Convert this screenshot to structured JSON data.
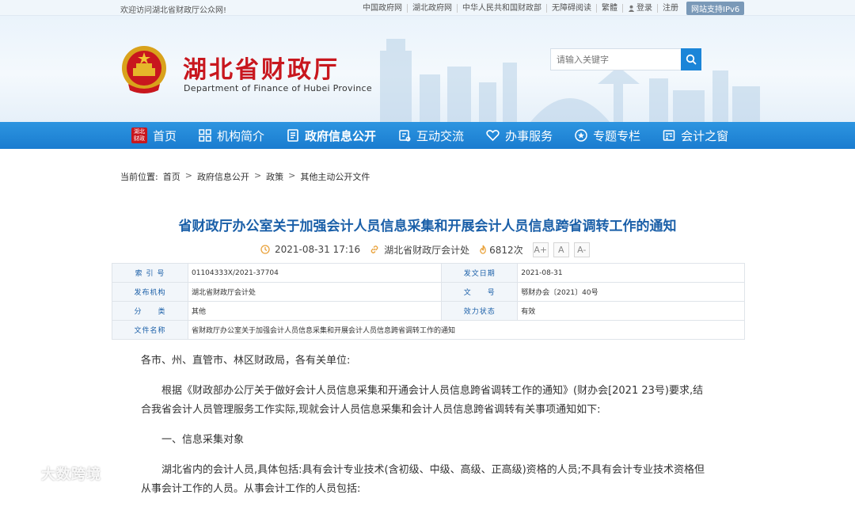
{
  "topbar": {
    "welcome": "欢迎访问湖北省财政厅公众网!",
    "links": [
      "中国政府网",
      "湖北政府网",
      "中华人民共和国财政部",
      "无障碍阅读",
      "繁體",
      "登录",
      "注册"
    ],
    "ipv6": "网站支持IPv6"
  },
  "header": {
    "title": "湖北省财政厅",
    "subtitle": "Department of Finance of Hubei Province",
    "search_placeholder": "请输入关键字"
  },
  "nav": {
    "home_badge": "湖北财政",
    "items": [
      "首页",
      "机构简介",
      "政府信息公开",
      "互动交流",
      "办事服务",
      "专题专栏",
      "会计之窗"
    ],
    "active": "政府信息公开"
  },
  "breadcrumb": {
    "label": "当前位置:",
    "items": [
      "首页",
      "政府信息公开",
      "政策",
      "其他主动公开文件"
    ],
    "sep": ">"
  },
  "article": {
    "title": "省财政厅办公室关于加强会计人员信息采集和开展会计人员信息跨省调转工作的通知",
    "date": "2021-08-31 17:16",
    "source": "湖北省财政厅会计处",
    "views": "6812次",
    "font_buttons": [
      "A+",
      "A",
      "A-"
    ]
  },
  "info_table": [
    [
      {
        "k": "索 引 号",
        "v": "01104333X/2021-37704"
      },
      {
        "k": "发文日期",
        "v": "2021-08-31"
      }
    ],
    [
      {
        "k": "发布机构",
        "v": "湖北省财政厅会计处"
      },
      {
        "k": "文　　号",
        "v": "鄂财办会〔2021〕40号"
      }
    ],
    [
      {
        "k": "分　　类",
        "v": "其他"
      },
      {
        "k": "效力状态",
        "v": "有效"
      }
    ],
    [
      {
        "k": "文件名称",
        "v": "省财政厅办公室关于加强会计人员信息采集和开展会计人员信息跨省调转工作的通知"
      }
    ]
  ],
  "body": {
    "p1": "各市、州、直管市、林区财政局，各有关单位:",
    "p2": "根据《财政部办公厅关于做好会计人员信息采集和开通会计人员信息跨省调转工作的通知》(财办会[2021 23号)要求,结合我省会计人员管理服务工作实际,现就会计人员信息采集和会计人员信息跨省调转有关事项通知如下:",
    "p3": "一、信息采集对象",
    "p4": "湖北省内的会计人员,具体包括:具有会计专业技术(含初级、中级、高级、正高级)资格的人员;不具有会计专业技术资格但从事会计工作的人员。从事会计工作的人员包括:"
  },
  "watermark": "大数跨境",
  "colors": {
    "nav": "#1a7cd0",
    "title_red": "#c8171e",
    "link_blue": "#1a5fa8"
  }
}
